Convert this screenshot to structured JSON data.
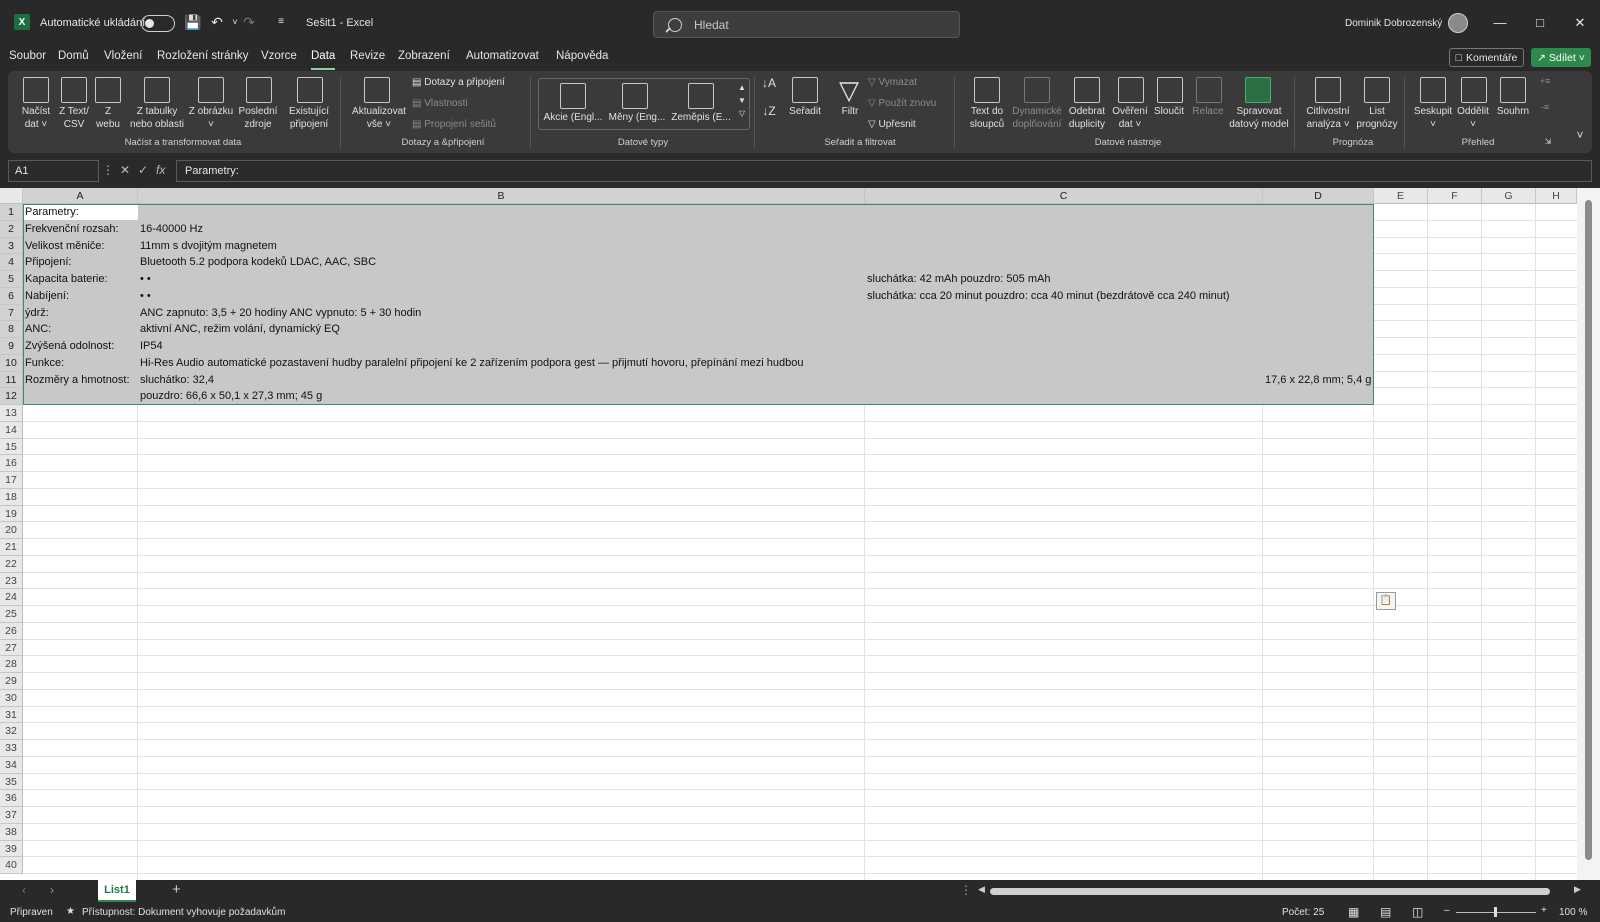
{
  "titlebar": {
    "autosave_label": "Automatické ukládání",
    "doc_title": "Sešit1 - Excel",
    "search_placeholder": "Hledat",
    "user_name": "Dominik Dobrozenský"
  },
  "menu": [
    "Soubor",
    "Domů",
    "Vložení",
    "Rozložení stránky",
    "Vzorce",
    "Data",
    "Revize",
    "Zobrazení",
    "Automatizovat",
    "Nápověda"
  ],
  "menu_active": "Data",
  "comments_label": "Komentáře",
  "share_label": "Sdílet",
  "ribbon": {
    "get_data": [
      [
        "Načíst",
        "dat ˅"
      ],
      [
        "Z Text/",
        "CSV"
      ],
      [
        "Z",
        "webu"
      ],
      [
        "Z tabulky",
        "nebo oblasti"
      ],
      [
        "Z obrázku",
        "˅"
      ],
      [
        "Poslední",
        "zdroje"
      ],
      [
        "Existující",
        "připojení"
      ]
    ],
    "group_get": "Načíst a transformovat data",
    "refresh": [
      "Aktualizovat",
      "vše ˅"
    ],
    "queries": [
      "Dotazy a připojení",
      "Vlastnosti",
      "Propojení sešitů"
    ],
    "group_queries": "Dotazy a &připojení",
    "datatypes": [
      "Akcie (Engl...",
      "Měny (Eng...",
      "Zeměpis (E..."
    ],
    "group_datatypes": "Datové typy",
    "sort_label": "Seřadit",
    "filter_label": "Filtr",
    "filter_opts": [
      "Vymazat",
      "Použít znovu",
      "Upřesnit"
    ],
    "group_sort": "Seřadit a filtrovat",
    "tools": [
      [
        "Text do",
        "sloupců"
      ],
      [
        "Dynamické",
        "doplňování"
      ],
      [
        "Odebrat",
        "duplicity"
      ],
      [
        "Ověření",
        "dat ˅"
      ],
      [
        "Sloučit",
        ""
      ],
      [
        "Relace",
        ""
      ],
      [
        "Spravovat",
        "datový model"
      ]
    ],
    "group_tools": "Datové nástroje",
    "forecast": [
      [
        "Citlivostní",
        "analýza ˅"
      ],
      [
        "List",
        "prognózy"
      ]
    ],
    "group_forecast": "Prognóza",
    "outline": [
      [
        "Seskupit",
        "˅"
      ],
      [
        "Oddělit",
        "˅"
      ],
      [
        "Souhrn",
        ""
      ]
    ],
    "group_outline": "Přehled"
  },
  "formula": {
    "namebox": "A1",
    "content": "Parametry:"
  },
  "columns": [
    "A",
    "B",
    "C",
    "D",
    "E",
    "F",
    "G",
    "H"
  ],
  "rows": [
    "1",
    "2",
    "3",
    "4",
    "5",
    "6",
    "7",
    "8",
    "9",
    "10",
    "11",
    "12",
    "13",
    "14",
    "15",
    "16",
    "17",
    "18",
    "19",
    "20",
    "21",
    "22",
    "23",
    "24",
    "25",
    "26",
    "27",
    "28",
    "29",
    "30",
    "31",
    "32",
    "33",
    "34",
    "35",
    "36",
    "37",
    "38",
    "39",
    "40"
  ],
  "cells": {
    "A1": "Parametry:",
    "A2": "Frekvenční rozsah:",
    "B2": "16-40000 Hz",
    "A3": "Velikost měniče:",
    "B3": "11mm s dvojitým magnetem",
    "A4": "Připojení:",
    "B4": "Bluetooth 5.2 podpora kodeků LDAC, AAC, SBC",
    "A5": "Kapacita baterie:",
    "B5": "• •",
    "C5": "sluchátka: 42 mAh pouzdro: 505 mAh",
    "A6": "Nabíjení:",
    "B6": "• •",
    "C6": "sluchátka: cca 20 minut pouzdro: cca 40 minut (bezdrátově cca 240 minut)",
    "A7": "ýdrž:",
    "B7": "ANC zapnuto: 3,5 + 20 hodiny ANC vypnuto: 5 + 30 hodin",
    "A8": "ANC:",
    "B8": "aktivní ANC, režim volání, dynamický EQ",
    "A9": "Zvýšená odolnost:",
    "B9": "IP54",
    "A10": "Funkce:",
    "B10": "Hi-Res Audio automatické pozastavení hudby paralelní připojení ke 2 zařízením podpora gest — přijmutí hovoru, přepínání mezi hudbou",
    "A11": "Rozměry a hmotnost:",
    "B11": "sluchátko: 32,4",
    "D11": "17,6 x 22,8 mm; 5,4 g",
    "B12": "pouzdro: 66,6 x 50,1 x 27,3 mm; 45 g"
  },
  "sheet_tab": "List1",
  "status": {
    "ready": "Připraven",
    "accessibility": "Přístupnost: Dokument vyhovuje požadavkům",
    "count": "Počet: 25",
    "zoom": "100 %"
  }
}
